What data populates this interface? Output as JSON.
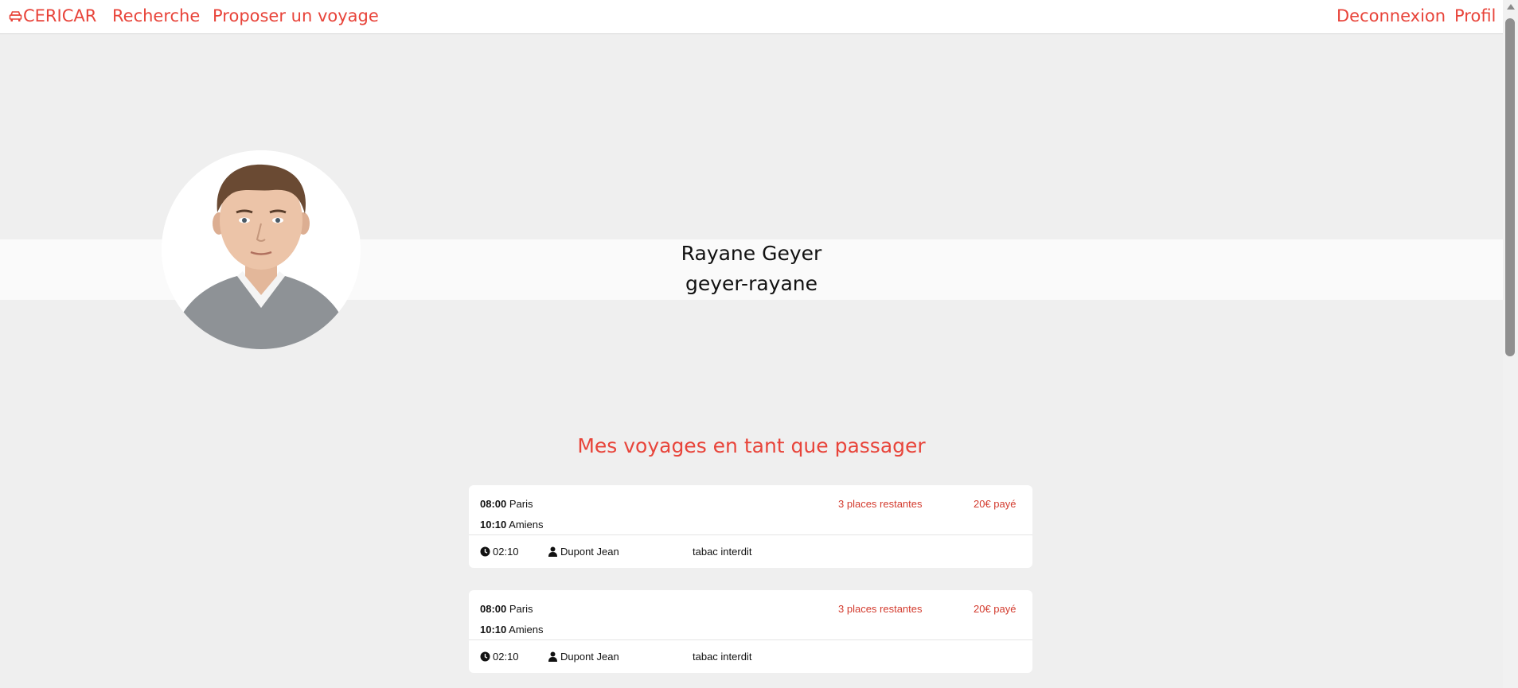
{
  "nav": {
    "brand": "CERICAR",
    "search": "Recherche",
    "propose": "Proposer un voyage",
    "logout": "Deconnexion",
    "profile": "Profil"
  },
  "colors": {
    "accent": "#e8443a",
    "price": "#d33b2e",
    "background": "#efefef"
  },
  "profile": {
    "full_name": "Rayane Geyer",
    "username": "geyer-rayane"
  },
  "section_title": "Mes voyages en tant que passager",
  "trips": [
    {
      "depart_time": "08:00",
      "depart_city": "Paris",
      "arrive_time": "10:10",
      "arrive_city": "Amiens",
      "places": "3 places restantes",
      "price": "20€ payé",
      "duration": "02:10",
      "driver": "Dupont Jean",
      "rule": "tabac interdit"
    },
    {
      "depart_time": "08:00",
      "depart_city": "Paris",
      "arrive_time": "10:10",
      "arrive_city": "Amiens",
      "places": "3 places restantes",
      "price": "20€ payé",
      "duration": "02:10",
      "driver": "Dupont Jean",
      "rule": "tabac interdit"
    }
  ]
}
